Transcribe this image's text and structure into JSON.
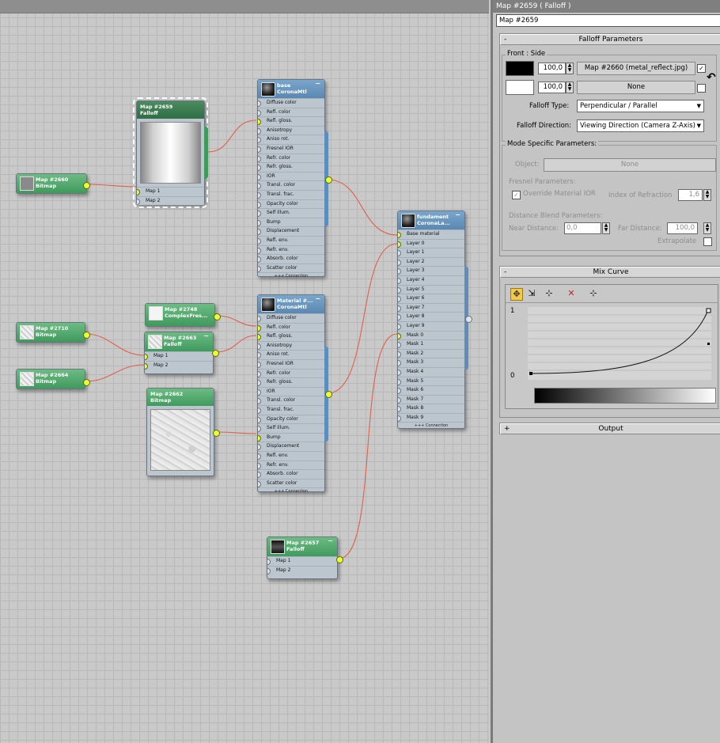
{
  "nodes": {
    "base": {
      "title": "base",
      "subtitle": "CoronaMtl",
      "slots": [
        "Diffuse color",
        "Refl. color",
        "Refl. gloss.",
        "Anisotropy",
        "Aniso rot.",
        "Fresnel IOR",
        "Refr. color",
        "Refr. gloss.",
        "IOR",
        "Transl. color",
        "Transl. frac.",
        "Opacity color",
        "Self illum.",
        "Bump",
        "Displacement",
        "Refl. env.",
        "Refr. env.",
        "Absorb. color",
        "Scatter color"
      ],
      "more": "+++ Connection"
    },
    "map2659": {
      "title": "Map #2659",
      "subtitle": "Falloff",
      "slots": [
        "Map 1",
        "Map 2"
      ]
    },
    "map2660": {
      "title": "Map #2660",
      "subtitle": "Bitmap"
    },
    "fundament": {
      "title": "fundament",
      "subtitle": "CoronaLa...",
      "slots": [
        "Base material",
        "Layer 0",
        "Layer 1",
        "Layer 2",
        "Layer 3",
        "Layer 4",
        "Layer 5",
        "Layer 6",
        "Layer 7",
        "Layer 8",
        "Layer 9",
        "Mask 0",
        "Mask 1",
        "Mask 2",
        "Mask 3",
        "Mask 4",
        "Mask 5",
        "Mask 6",
        "Mask 7",
        "Mask 8",
        "Mask 9"
      ],
      "more": "+++ Connection"
    },
    "material": {
      "title": "Material #...",
      "subtitle": "CoronaMtl",
      "slots": [
        "Diffuse color",
        "Refl. color",
        "Refl. gloss.",
        "Anisotropy",
        "Aniso rot.",
        "Fresnel IOR",
        "Refr. color",
        "Refr. gloss.",
        "IOR",
        "Transl. color",
        "Transl. frac.",
        "Opacity color",
        "Self illum.",
        "Bump",
        "Displacement",
        "Refl. env.",
        "Refr. env.",
        "Absorb. color",
        "Scatter color"
      ],
      "more": "+++ Connection"
    },
    "map2748": {
      "title": "Map #2748",
      "subtitle": "ComplexFres..."
    },
    "map2663": {
      "title": "Map #2663",
      "subtitle": "Falloff",
      "slots": [
        "Map 1",
        "Map 2"
      ]
    },
    "map2710": {
      "title": "Map #2710",
      "subtitle": "Bitmap"
    },
    "map2664": {
      "title": "Map #2664",
      "subtitle": "Bitmap"
    },
    "map2662": {
      "title": "Map #2662",
      "subtitle": "Bitmap"
    },
    "map2657": {
      "title": "Map #2657",
      "subtitle": "Falloff",
      "slots": [
        "Map 1",
        "Map 2"
      ]
    }
  },
  "panel": {
    "title": "Map #2659  ( Falloff )",
    "map_name": "Map #2659",
    "falloff": {
      "header": "Falloff Parameters",
      "collapse": "-",
      "group": "Front : Side",
      "front_amount": "100,0",
      "front_map": "Map #2660 (metal_reflect.jpg)",
      "front_checked": "✓",
      "side_amount": "100,0",
      "side_map": "None",
      "swap_icon": "↶",
      "type_label": "Falloff Type:",
      "type_value": "Perpendicular / Parallel",
      "direction_label": "Falloff Direction:",
      "direction_value": "Viewing Direction (Camera Z-Axis)"
    },
    "mode": {
      "group": "Mode Specific Parameters:",
      "object_label": "Object:",
      "object_value": "None",
      "fresnel_label": "Fresnel Parameters:",
      "override_label": "Override Material IOR",
      "override_checked": "✓",
      "ior_label": "Index of Refraction",
      "ior_value": "1,6",
      "distance_label": "Distance Blend Parameters:",
      "near_label": "Near Distance:",
      "near_value": "0,0",
      "far_label": "Far Distance:",
      "far_value": "100,0",
      "extrapolate_label": "Extrapolate"
    },
    "mix_curve": {
      "header": "Mix Curve",
      "collapse": "-",
      "y_top": "1",
      "y_bottom": "0"
    },
    "output": {
      "header": "Output",
      "collapse": "+"
    }
  },
  "colors": {
    "wire": "#e0604a",
    "slot_on": "#eaff3a",
    "material_header": "#5a88b2",
    "map_header": "#3f9a5d"
  }
}
